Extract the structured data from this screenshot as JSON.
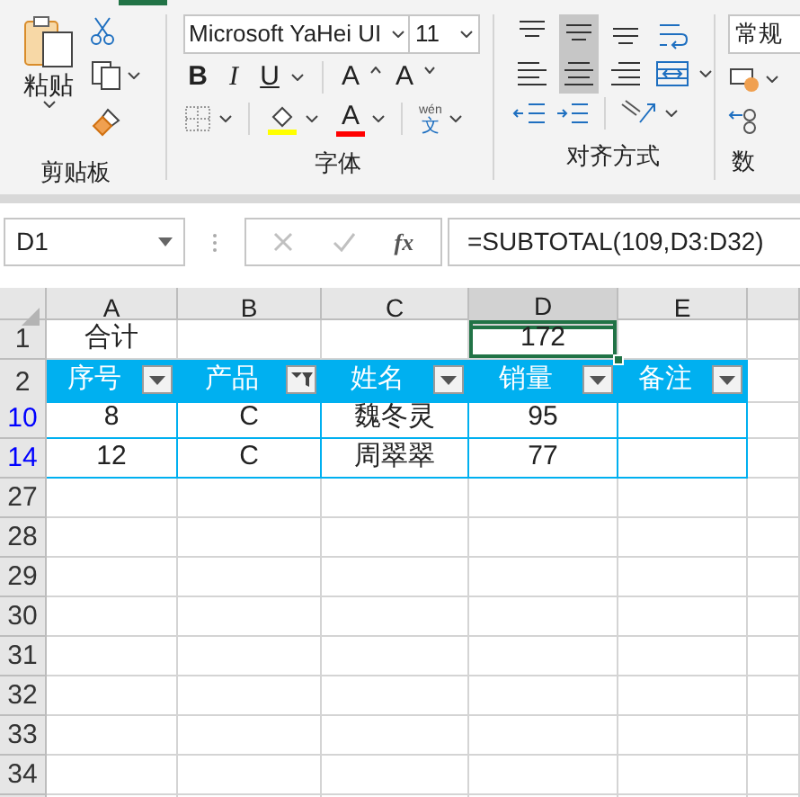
{
  "ribbon": {
    "clipboard": {
      "paste_label": "粘贴",
      "label": "剪贴板"
    },
    "font": {
      "font_name": "Microsoft YaHei UI",
      "font_size": "11",
      "bold": "B",
      "italic": "I",
      "underline": "U",
      "grow": "A",
      "shrink": "A",
      "font_color": "A",
      "phonetic_top": "wén",
      "phonetic_bottom": "文",
      "label": "字体"
    },
    "alignment": {
      "label": "对齐方式",
      "buttons": [
        {
          "kind": "top",
          "selected": false
        },
        {
          "kind": "middle",
          "selected": true
        },
        {
          "kind": "bottom",
          "selected": false
        },
        {
          "kind": "wrap",
          "selected": false
        },
        {
          "kind": "left",
          "selected": false
        },
        {
          "kind": "center",
          "selected": true
        },
        {
          "kind": "right",
          "selected": false
        },
        {
          "kind": "merge",
          "selected": false
        }
      ]
    },
    "number": {
      "format": "常规",
      "label": "数"
    }
  },
  "formula_bar": {
    "name_box": "D1",
    "fx": "fx",
    "formula": "=SUBTOTAL(109,D3:D32)"
  },
  "sheet": {
    "columns": [
      {
        "label": "A",
        "selected": false
      },
      {
        "label": "B",
        "selected": false
      },
      {
        "label": "C",
        "selected": false
      },
      {
        "label": "D",
        "selected": true
      },
      {
        "label": "E",
        "selected": false
      }
    ],
    "rows": [
      {
        "number": "1",
        "kind": "plain",
        "filtered": false,
        "cells": [
          {
            "text": "合计",
            "active": false
          },
          null,
          null,
          {
            "text": "172",
            "active": true
          },
          null
        ]
      },
      {
        "number": "2",
        "kind": "header",
        "filtered": false,
        "cells": [
          {
            "text": "序号",
            "filtered": false
          },
          {
            "text": "产品",
            "filtered": true
          },
          {
            "text": "姓名",
            "filtered": false
          },
          {
            "text": "销量",
            "filtered": false
          },
          {
            "text": "备注",
            "filtered": false
          }
        ]
      },
      {
        "number": "10",
        "kind": "data",
        "filtered": true,
        "cells": [
          {
            "text": "8",
            "active": false
          },
          {
            "text": "C",
            "active": false
          },
          {
            "text": "魏冬灵",
            "active": false
          },
          {
            "text": "95",
            "active": false
          },
          null
        ]
      },
      {
        "number": "14",
        "kind": "data",
        "filtered": true,
        "cells": [
          {
            "text": "12",
            "active": false
          },
          {
            "text": "C",
            "active": false
          },
          {
            "text": "周翠翠",
            "active": false
          },
          {
            "text": "77",
            "active": false
          },
          null
        ]
      },
      {
        "number": "27",
        "kind": "plain",
        "filtered": false
      },
      {
        "number": "28",
        "kind": "plain",
        "filtered": false
      },
      {
        "number": "29",
        "kind": "plain",
        "filtered": false
      },
      {
        "number": "30",
        "kind": "plain",
        "filtered": false
      },
      {
        "number": "31",
        "kind": "plain",
        "filtered": false
      },
      {
        "number": "32",
        "kind": "plain",
        "filtered": false
      },
      {
        "number": "33",
        "kind": "plain",
        "filtered": false
      },
      {
        "number": "34",
        "kind": "plain",
        "filtered": false
      },
      {
        "kind": "plain"
      }
    ]
  }
}
